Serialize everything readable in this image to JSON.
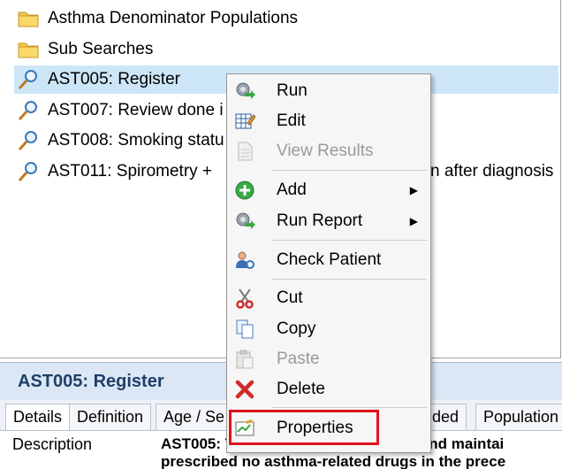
{
  "tree": {
    "items": [
      {
        "label": "Asthma Denominator Populations",
        "icon": "folder-icon"
      },
      {
        "label": "Sub Searches",
        "icon": "folder-icon"
      },
      {
        "label": "AST005: Register",
        "icon": "search-magnifier-icon"
      },
      {
        "label": "AST007: Review done i",
        "icon": "search-magnifier-icon"
      },
      {
        "label": "AST008: Smoking statu",
        "icon": "search-magnifier-icon"
      },
      {
        "label": "AST011: Spirometry + ",
        "tail": "n after diagnosis",
        "icon": "search-magnifier-icon"
      }
    ]
  },
  "details": {
    "title": "AST005: Register",
    "tabs": [
      "Details",
      "Definition",
      "Age / Se",
      "uded",
      "Population"
    ],
    "description_label": "Description",
    "description_line1": "AST005: The contractor establishes and maintai",
    "description_line2": "prescribed no asthma-related drugs in the prece"
  },
  "menu": {
    "items": [
      {
        "label": "Run",
        "icon": "run-icon"
      },
      {
        "label": "Edit",
        "icon": "edit-grid-icon"
      },
      {
        "label": "View Results",
        "icon": "document-icon",
        "disabled": true
      },
      {
        "label": "Add",
        "icon": "add-plus-icon",
        "submenu": true
      },
      {
        "label": "Run Report",
        "icon": "run-report-icon",
        "submenu": true
      },
      {
        "label": "Check Patient",
        "icon": "check-patient-icon"
      },
      {
        "label": "Cut",
        "icon": "scissors-icon"
      },
      {
        "label": "Copy",
        "icon": "copy-icon"
      },
      {
        "label": "Paste",
        "icon": "paste-icon",
        "disabled": true
      },
      {
        "label": "Delete",
        "icon": "delete-x-icon"
      },
      {
        "label": "Properties",
        "icon": "properties-icon"
      }
    ],
    "submenu_arrow": "▶"
  },
  "colors": {
    "selection": "#cde6f7",
    "highlight_box": "#e0141b",
    "header_bg": "#dbe7f4",
    "title_text": "#1f3f68"
  }
}
